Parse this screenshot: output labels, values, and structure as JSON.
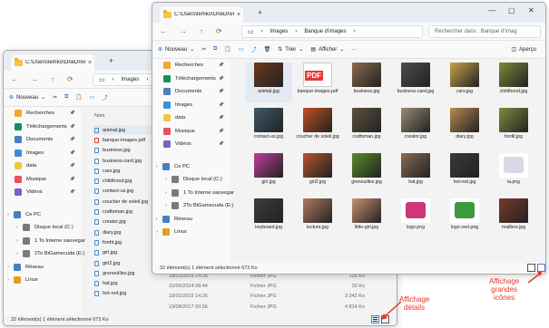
{
  "window_back": {
    "tab_title": "C:\\Users\\lemko\\OneDrive\\Pict",
    "breadcrumb": [
      "Images",
      "Ba"
    ],
    "new_label": "Nouveau",
    "sidebar": [
      {
        "label": "Recherches",
        "color": "#f0a830"
      },
      {
        "label": "Téléchargements",
        "color": "#1a8d5f"
      },
      {
        "label": "Documents",
        "color": "#4a7fc1"
      },
      {
        "label": "Images",
        "color": "#3a8fd8"
      },
      {
        "label": "data",
        "color": "#f5c542"
      },
      {
        "label": "Musique",
        "color": "#e8505b"
      },
      {
        "label": "Vidéos",
        "color": "#7b5fc7"
      }
    ],
    "tree": [
      {
        "label": "Ce PC",
        "color": "#4a7fc1"
      },
      {
        "label": "Disque local (C:)",
        "color": "#7a7a7a"
      },
      {
        "label": "1 To Interne sauvegar",
        "color": "#7a7a7a"
      },
      {
        "label": "2To BiGamecuda (E:)",
        "color": "#7a7a7a"
      },
      {
        "label": "Réseau",
        "color": "#4a7fc1"
      },
      {
        "label": "Linux",
        "color": "#e0a020"
      }
    ],
    "column_name": "Nom",
    "files": [
      "animal.jpg",
      "banque-images.pdf",
      "business.jpg",
      "business-card.jpg",
      "cars.jpg",
      "childhood.jpg",
      "contact-us.jpg",
      "coucher de soleil.jpg",
      "craftsman.jpg",
      "creator.jpg",
      "diary.jpg",
      "fordit.jpg",
      "girl.jpg",
      "girl2.jpg",
      "grenouilles.jpg",
      "hat.jpg",
      "hot-rod.jpg"
    ],
    "detail_rows": [
      {
        "date": "18/01/2019 14:26",
        "type": "Fichier JPG",
        "size": "125 Ko"
      },
      {
        "date": "15/05/2024 08:44",
        "type": "Fichier JPG",
        "size": "33 Ko"
      },
      {
        "date": "18/01/2019 14:26",
        "type": "Fichier JPG",
        "size": "3 342 Ko"
      },
      {
        "date": "19/08/2017 00:56",
        "type": "Fichier JPG",
        "size": "4 814 Ko"
      }
    ],
    "status": "32 élément(s)   1 élément sélectionné  673 Ko"
  },
  "window_front": {
    "tab_title": "C:\\Users\\lemko\\OneDrive\\Pict",
    "breadcrumb": [
      "Images",
      "Banque d'images"
    ],
    "search_placeholder": "Rechercher dans : Banque d'imag",
    "new_label": "Nouveau",
    "sort_label": "Trier",
    "view_label": "Afficher",
    "preview_label": "Aperçu",
    "sidebar": [
      {
        "label": "Recherches",
        "color": "#f0a830"
      },
      {
        "label": "Téléchargements",
        "color": "#1a8d5f"
      },
      {
        "label": "Documents",
        "color": "#4a7fc1"
      },
      {
        "label": "Images",
        "color": "#3a8fd8"
      },
      {
        "label": "data",
        "color": "#f5c542"
      },
      {
        "label": "Musique",
        "color": "#e8505b"
      },
      {
        "label": "Vidéos",
        "color": "#7b5fc7"
      }
    ],
    "tree": [
      {
        "label": "Ce PC",
        "color": "#4a7fc1"
      },
      {
        "label": "Disque local (C:)",
        "color": "#7a7a7a"
      },
      {
        "label": "1 To Interne sauvegar",
        "color": "#7a7a7a"
      },
      {
        "label": "2To BiGamecuda (E:)",
        "color": "#7a7a7a"
      },
      {
        "label": "Réseau",
        "color": "#4a7fc1"
      },
      {
        "label": "Linux",
        "color": "#e0a020"
      }
    ],
    "items": [
      {
        "label": "animal.jpg",
        "color": "#6b3a1e"
      },
      {
        "label": "banque-images.pdf",
        "color": "#e53935"
      },
      {
        "label": "business.jpg",
        "color": "#8a6b4c"
      },
      {
        "label": "business-card.jpg",
        "color": "#4d4d4d"
      },
      {
        "label": "cars.jpg",
        "color": "#c9a24a"
      },
      {
        "label": "childhood.jpg",
        "color": "#7a8a3a"
      },
      {
        "label": "contact-us.jpg",
        "color": "#3f5a6b"
      },
      {
        "label": "coucher de soleil.jpg",
        "color": "#c0501e"
      },
      {
        "label": "craftsman.jpg",
        "color": "#5e5040"
      },
      {
        "label": "creator.jpg",
        "color": "#9a8a78"
      },
      {
        "label": "diary.jpg",
        "color": "#b98a52"
      },
      {
        "label": "fordit.jpg",
        "color": "#7f8c3e"
      },
      {
        "label": "girl.jpg",
        "color": "#c23d9c"
      },
      {
        "label": "girl2.jpg",
        "color": "#b5542d"
      },
      {
        "label": "grenouilles.jpg",
        "color": "#5a8a2a"
      },
      {
        "label": "hat.jpg",
        "color": "#8a6a52"
      },
      {
        "label": "hot-rod.jpg",
        "color": "#3a3a3a"
      },
      {
        "label": "ia.png",
        "color": "#d8d8e8"
      },
      {
        "label": "keyboard.jpg",
        "color": "#3c3c3c"
      },
      {
        "label": "lecture.jpg",
        "color": "#b07a60"
      },
      {
        "label": "little-girl.jpg",
        "color": "#c89070"
      },
      {
        "label": "logo.png",
        "color": "#d0357c"
      },
      {
        "label": "logo-vert.png",
        "color": "#3c9a3c"
      },
      {
        "label": "mailbox.jpg",
        "color": "#7a3a2a"
      }
    ],
    "status": "32 élément(s)   1 élément sélectionné  673 Ko"
  },
  "annotations": {
    "details": "Affichage\ndétails",
    "large_icons": "Affichage\ngrandes\nicônes"
  },
  "colors": {
    "annotation": "#e8372c",
    "accent": "#1a6fd1",
    "selection": "#e3eaf2"
  }
}
